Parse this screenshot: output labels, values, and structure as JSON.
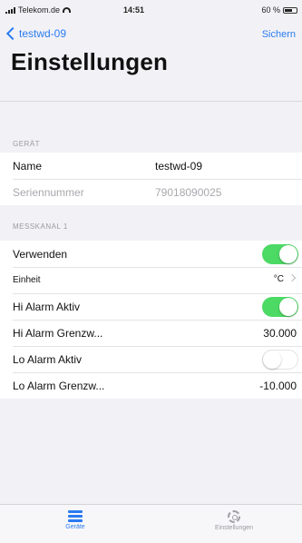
{
  "status_bar": {
    "carrier": "Telekom.de",
    "time": "14:51",
    "battery": "60 %"
  },
  "nav": {
    "back_label": "testwd-09",
    "save_label": "Sichern"
  },
  "page_title": "Einstellungen",
  "device_section": {
    "header": "GERÄT",
    "name_label": "Name",
    "name_value": "testwd-09",
    "serial_label": "Seriennummer",
    "serial_value": "79018090025"
  },
  "channel_section": {
    "header": "MESSKANAL 1",
    "use_label": "Verwenden",
    "use_enabled": true,
    "unit_label": "Einheit",
    "unit_value": "°C",
    "hi_active_label": "Hi Alarm Aktiv",
    "hi_active_enabled": true,
    "hi_limit_label": "Hi Alarm Grenzw...",
    "hi_limit_value": "30.000",
    "lo_active_label": "Lo Alarm Aktiv",
    "lo_active_enabled": false,
    "lo_limit_label": "Lo Alarm Grenzw...",
    "lo_limit_value": "-10.000"
  },
  "tab_bar": {
    "tabs": [
      {
        "label": "Geräte",
        "icon": "list-icon",
        "active": true
      },
      {
        "label": "Einstellungen",
        "icon": "gear-icon",
        "active": false
      }
    ]
  },
  "colors": {
    "accent": "#2b7bf0",
    "switch_on": "#4cd964",
    "background": "#f2f2f6"
  }
}
